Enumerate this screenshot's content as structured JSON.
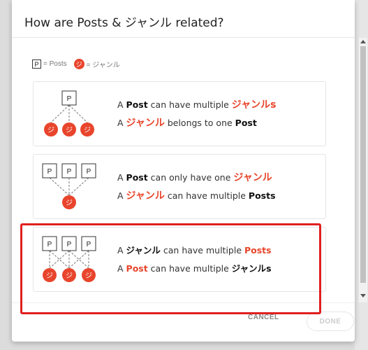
{
  "dialog": {
    "title": "How are Posts & ジャンル related?"
  },
  "legend": {
    "p_symbol": "P",
    "p_label": "= Posts",
    "j_symbol": "ジ",
    "j_label": "= ジャンル"
  },
  "options": [
    {
      "line1": [
        "A ",
        "Post",
        " can have multiple ",
        "ジャンルs"
      ],
      "line2": [
        "A ",
        "ジャンル",
        " belongs to one ",
        "Post"
      ]
    },
    {
      "line1": [
        "A ",
        "Post",
        " can only have one ",
        "ジャンル"
      ],
      "line2": [
        "A ",
        "ジャンル",
        " can have multiple ",
        "Posts"
      ]
    },
    {
      "line1": [
        "A ",
        "ジャンル",
        " can have multiple ",
        "Posts"
      ],
      "line2": [
        "A ",
        "Post",
        " can have multiple ",
        "ジャンルs"
      ]
    }
  ],
  "diagram": {
    "p": "P",
    "j": "ジ"
  },
  "footer": {
    "cancel": "CANCEL",
    "done": "DONE"
  },
  "colors": {
    "accent": "#e8452c",
    "highlight": "#e02020"
  }
}
